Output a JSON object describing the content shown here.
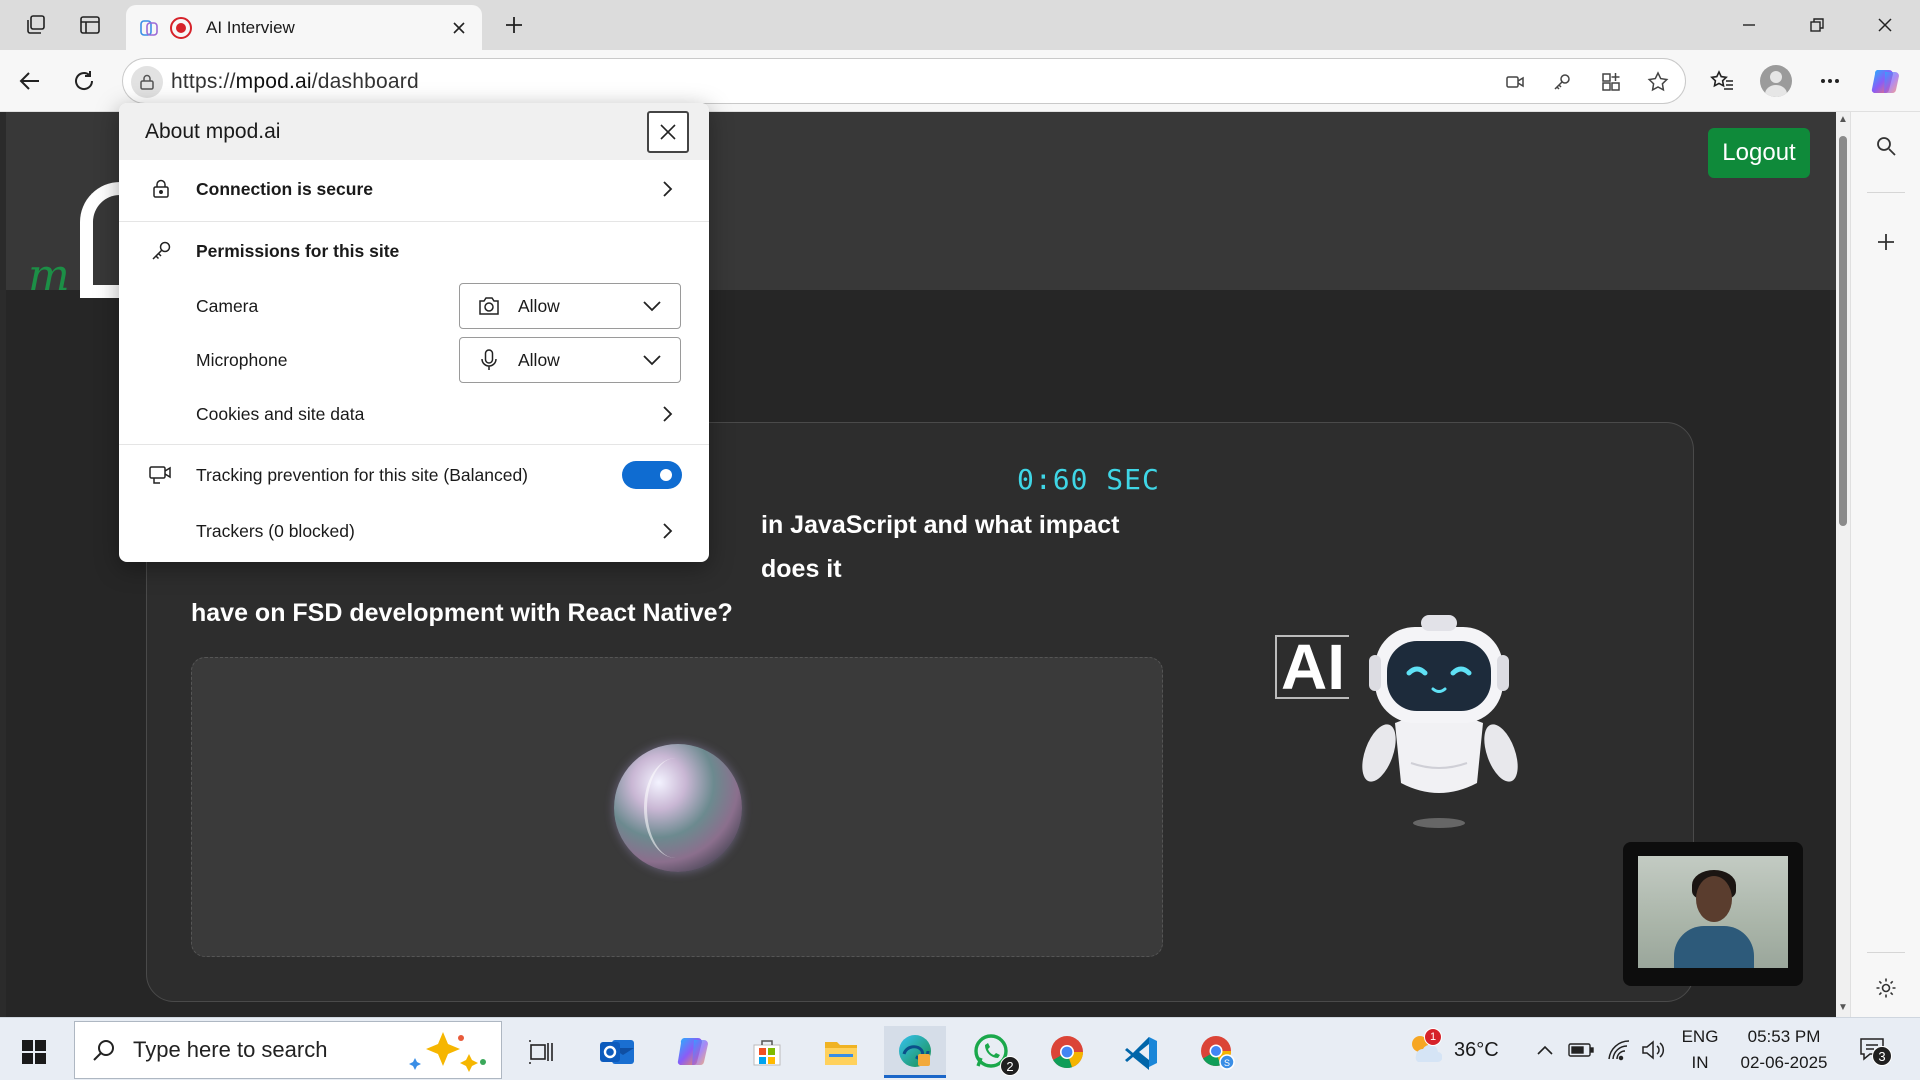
{
  "browser": {
    "tab_title": "AI Interview",
    "url_scheme": "https://",
    "url_host": "mpod.ai",
    "url_path": "/dashboard"
  },
  "flyout": {
    "title": "About mpod.ai",
    "connection_label": "Connection is secure",
    "permissions_label": "Permissions for this site",
    "camera_label": "Camera",
    "camera_value": "Allow",
    "microphone_label": "Microphone",
    "microphone_value": "Allow",
    "cookies_label": "Cookies and site data",
    "tracking_label": "Tracking prevention for this site (Balanced)",
    "tracking_enabled": true,
    "trackers_label": "Trackers (0 blocked)"
  },
  "page": {
    "logout_label": "Logout",
    "timer": "0:60 SEC",
    "question_line1": "in JavaScript and what impact does it",
    "question_line2": "have on FSD development with React Native?",
    "ai_badge": "AI"
  },
  "taskbar": {
    "search_placeholder": "Type here to search",
    "weather_temp": "36°C",
    "weather_badge": "1",
    "lang_top": "ENG",
    "lang_bottom": "IN",
    "time": "05:53 PM",
    "date": "02-06-2025",
    "notifications_count": "3",
    "whatsapp_badge": "2"
  },
  "colors": {
    "logout_green": "#0f8a3a",
    "timer_cyan": "#3fd6e6",
    "toggle_blue": "#0f6cd1",
    "accent_blue": "#1a66c8"
  }
}
